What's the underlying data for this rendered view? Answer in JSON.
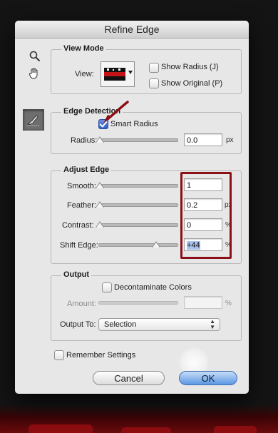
{
  "window": {
    "title": "Refine Edge"
  },
  "tools": {
    "zoom_icon": "magnifier-icon",
    "hand_icon": "hand-icon",
    "brush_icon": "refine-radius-brush-icon"
  },
  "view_mode": {
    "title": "View Mode",
    "view_label": "View:",
    "show_radius": {
      "label": "Show Radius (J)",
      "checked": false
    },
    "show_original": {
      "label": "Show Original (P)",
      "checked": false
    }
  },
  "edge_detection": {
    "title": "Edge Detection",
    "smart_radius": {
      "label": "Smart Radius",
      "checked": true
    },
    "radius": {
      "label": "Radius:",
      "value": "0.0",
      "unit": "px",
      "level": 0
    }
  },
  "adjust_edge": {
    "title": "Adjust Edge",
    "smooth": {
      "label": "Smooth:",
      "value": "1",
      "unit": "",
      "level": 0
    },
    "feather": {
      "label": "Feather:",
      "value": "0.2",
      "unit": "px",
      "level": 0
    },
    "contrast": {
      "label": "Contrast:",
      "value": "0",
      "unit": "%",
      "level": 0
    },
    "shift_edge": {
      "label": "Shift Edge:",
      "value": "+44",
      "unit": "%",
      "level": 0.72
    }
  },
  "output": {
    "title": "Output",
    "decontaminate": {
      "label": "Decontaminate Colors",
      "checked": false
    },
    "amount": {
      "label": "Amount:",
      "value": "",
      "unit": "%"
    },
    "output_to": {
      "label": "Output To:",
      "selected": "Selection"
    }
  },
  "remember": {
    "label": "Remember Settings",
    "checked": false
  },
  "buttons": {
    "cancel": "Cancel",
    "ok": "OK"
  },
  "colors": {
    "annotation_red": "#8b0f16",
    "ok_blue": "#5a97e3"
  }
}
